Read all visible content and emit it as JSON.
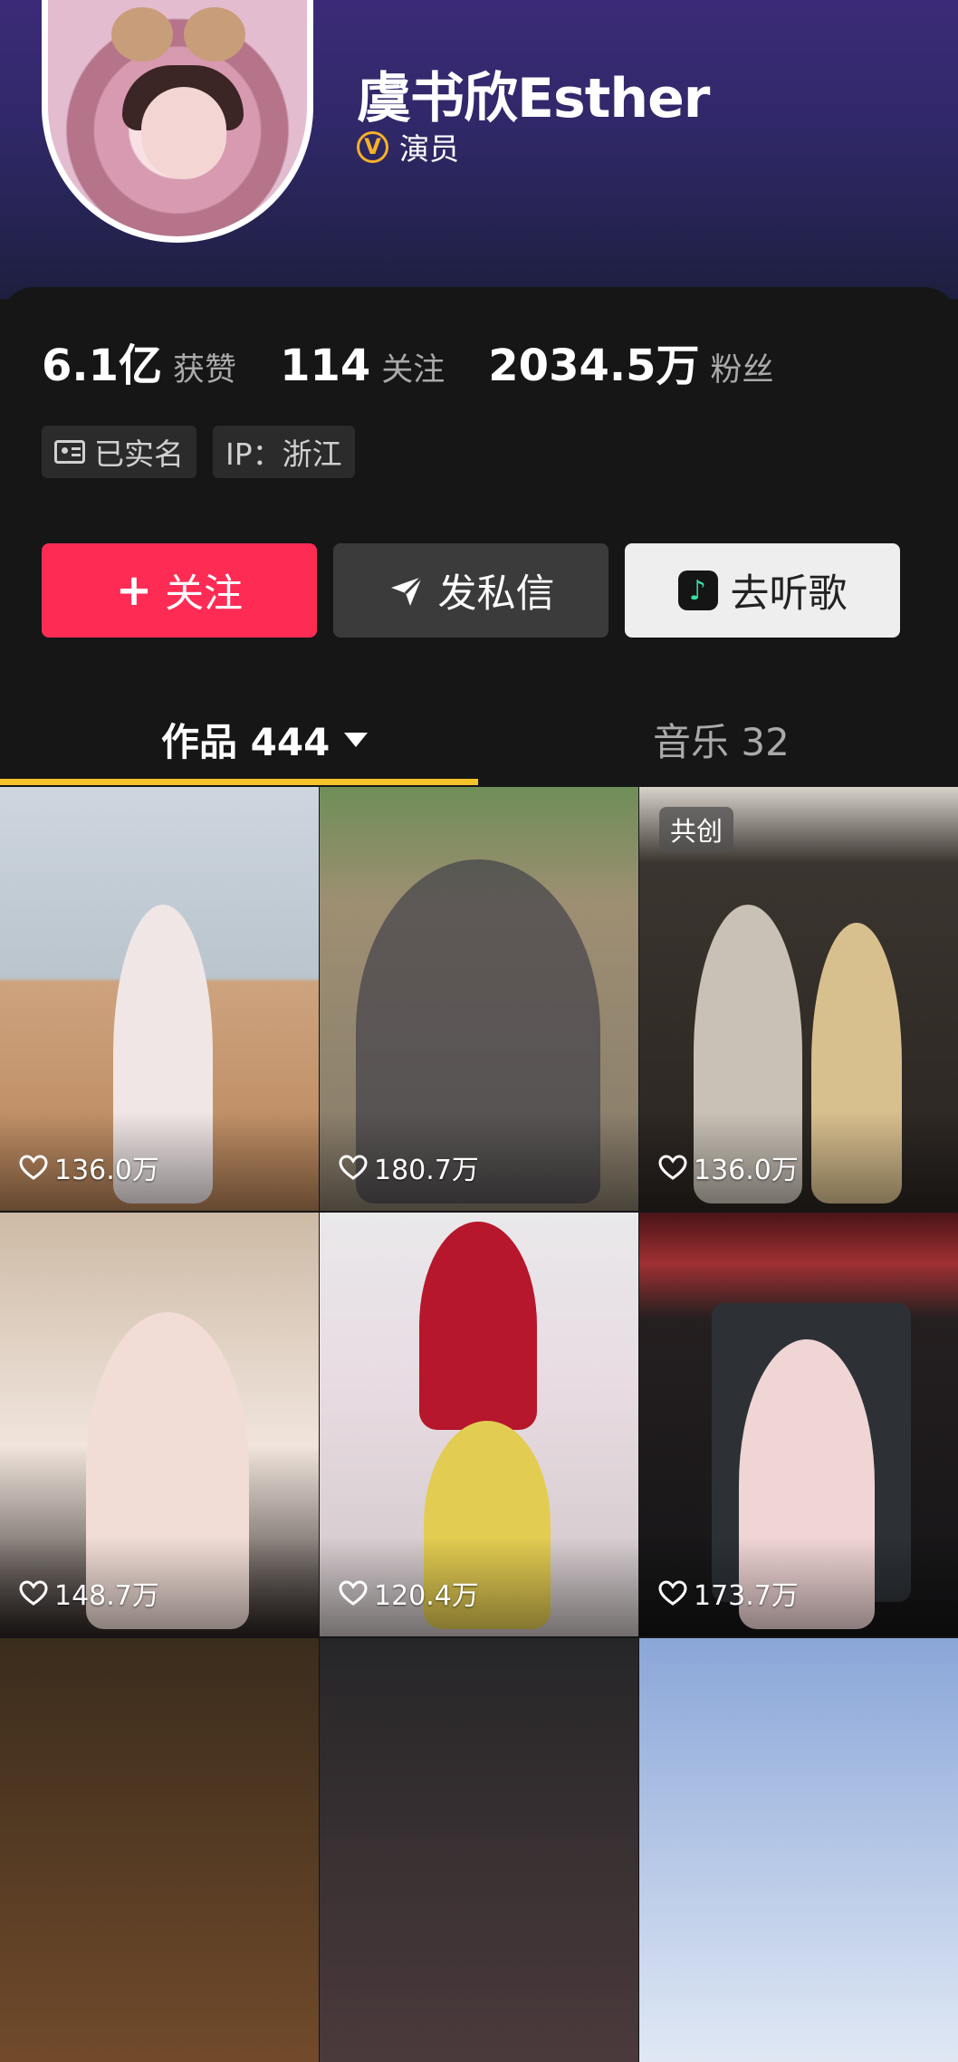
{
  "profile": {
    "name": "虞书欣Esther",
    "cert_badge": "V",
    "cert_label": "演员",
    "avatar_icon": "avatar"
  },
  "stats": [
    {
      "value": "6.1亿",
      "label": "获赞"
    },
    {
      "value": "114",
      "label": "关注"
    },
    {
      "value": "2034.5万",
      "label": "粉丝"
    }
  ],
  "tags": {
    "verified": "已实名",
    "ip": "IP：浙江"
  },
  "actions": {
    "follow": "关注",
    "follow_icon": "+",
    "message": "发私信",
    "music": "去听歌",
    "music_icon": "♪"
  },
  "tabs": {
    "works": "作品 444",
    "music": "音乐 32"
  },
  "colors": {
    "follow_button": "#fe2c55",
    "tab_indicator": "#f6c229",
    "header_top": "#3c2a78"
  },
  "grid": [
    {
      "likes": "136.0万",
      "tag": ""
    },
    {
      "likes": "180.7万",
      "tag": ""
    },
    {
      "likes": "136.0万",
      "tag": "共创"
    },
    {
      "likes": "148.7万",
      "tag": ""
    },
    {
      "likes": "120.4万",
      "tag": ""
    },
    {
      "likes": "173.7万",
      "tag": ""
    }
  ]
}
